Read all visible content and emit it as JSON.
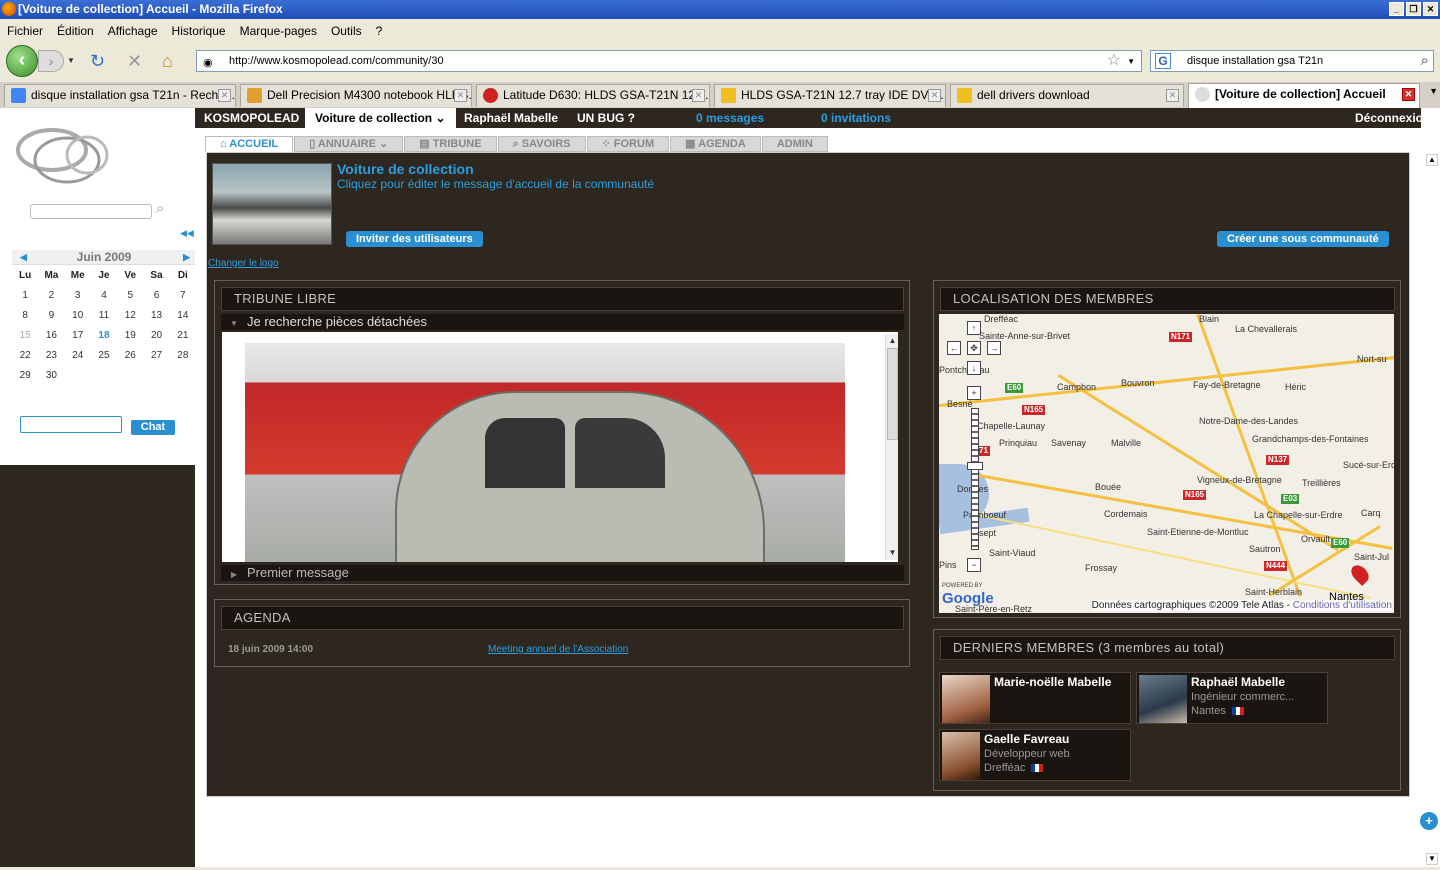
{
  "window": {
    "title": "[Voiture de collection] Accueil - Mozilla Firefox"
  },
  "menu": [
    "Fichier",
    "Édition",
    "Affichage",
    "Historique",
    "Marque-pages",
    "Outils",
    "?"
  ],
  "address": {
    "url": "http://www.kosmopolead.com/community/30"
  },
  "search": {
    "value": "disque installation gsa T21n"
  },
  "tabs": [
    {
      "label": "disque installation gsa T21n - Reche...",
      "color": "#4285f4"
    },
    {
      "label": "Dell Precision M4300 notebook HLDS...",
      "color": "#e0a030"
    },
    {
      "label": "Latitude D630: HLDS GSA-T21N 12....",
      "color": "#d02020"
    },
    {
      "label": "HLDS GSA-T21N 12.7 tray IDE DVD...",
      "color": "#f0c020"
    },
    {
      "label": "dell drivers download",
      "color": "#f0c020"
    },
    {
      "label": "[Voiture de collection] Accueil",
      "color": "#888888"
    }
  ],
  "calendar": {
    "month": "Juin 2009",
    "days": [
      "Lu",
      "Ma",
      "Me",
      "Je",
      "Ve",
      "Sa",
      "Di"
    ],
    "weeks": [
      [
        "1",
        "2",
        "3",
        "4",
        "5",
        "6",
        "7"
      ],
      [
        "8",
        "9",
        "10",
        "11",
        "12",
        "13",
        "14"
      ],
      [
        "15",
        "16",
        "17",
        "18",
        "19",
        "20",
        "21"
      ],
      [
        "22",
        "23",
        "24",
        "25",
        "26",
        "27",
        "28"
      ],
      [
        "29",
        "30",
        "",
        "",
        "",
        "",
        ""
      ]
    ],
    "today": "18"
  },
  "chat": {
    "button": "Chat"
  },
  "topnav": {
    "brand": "KOSMOPOLEAD",
    "community": "Voiture de collection",
    "user": "Raphaël Mabelle",
    "bug": "UN BUG ?",
    "messages": "0 messages",
    "invitations": "0 invitations",
    "logout": "Déconnexion"
  },
  "subnav": [
    "ACCUEIL",
    "ANNUAIRE",
    "TRIBUNE",
    "SAVOIRS",
    "FORUM",
    "AGENDA",
    "ADMIN"
  ],
  "community": {
    "title": "Voiture de collection",
    "subtitle": "Cliquez pour éditer le message d'accueil de la communauté",
    "invite_btn": "Inviter des utilisateurs",
    "subcomm_btn": "Créer une sous communauté",
    "change_logo": "Changer le logo"
  },
  "tribune": {
    "title": "TRIBUNE LIBRE",
    "post": "Je recherche pièces détachées",
    "first": "Premier message"
  },
  "agenda": {
    "title": "AGENDA",
    "date": "18 juin 2009 14:00",
    "event": "Meeting annuel de l'Association"
  },
  "map": {
    "title": "LOCALISATION DES MEMBRES",
    "places": [
      "Blain",
      "La Chevallerais",
      "Sainte-Anne-sur-Brivet",
      "Nort-su",
      "Campbon",
      "Bouvron",
      "Fay-de-Bretagne",
      "Héric",
      "Notre-Dame-des-Landes",
      "Chapelle-Launay",
      "Prinquiau",
      "Savenay",
      "Malville",
      "Grandchamps-des-Fontaines",
      "Sucé-sur-Erd",
      "Treillières",
      "Bouée",
      "Vigneux-de-Bretagne",
      "Cordemais",
      "La Chapelle-sur-Erdre",
      "Saint-Etienne-de-Montluc",
      "Orvault",
      "Sautron",
      "Paimboeuf",
      "Saint-Viaud",
      "Frossay",
      "Saint-Herblain",
      "Nantes",
      "Saint-Père-en-Retz",
      "Drefféac",
      "Besné",
      "Carq",
      "Saint-Jul",
      "Pins",
      "Donges",
      "sept"
    ],
    "roads": [
      "N171",
      "E60",
      "N165",
      "N137",
      "E03",
      "N444",
      "E60",
      "71",
      "N165"
    ],
    "powered": "POWERED BY",
    "google": "Google",
    "attribution": "Données cartographiques ©2009 Tele Atlas - ",
    "terms": "Conditions d'utilisation"
  },
  "members": {
    "title": "DERNIERS MEMBRES (3 membres au total)",
    "list": [
      {
        "name": "Marie-noëlle Mabelle",
        "job": "",
        "city": ""
      },
      {
        "name": "Raphaël Mabelle",
        "job": "Ingénieur commerc...",
        "city": "Nantes"
      },
      {
        "name": "Gaelle Favreau",
        "job": "Développeur web",
        "city": "Drefféac"
      }
    ]
  }
}
